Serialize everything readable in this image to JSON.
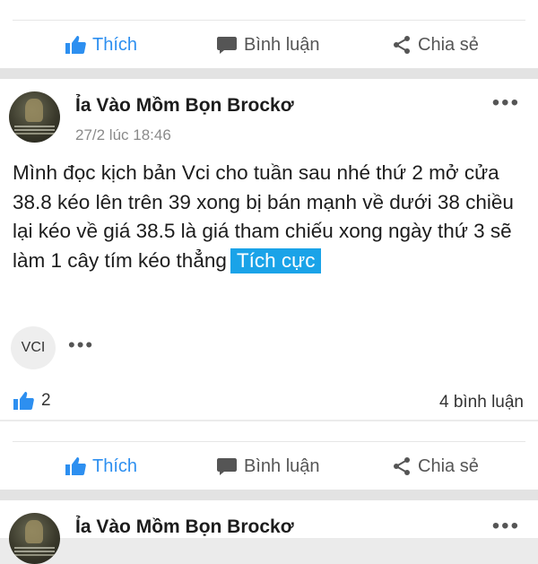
{
  "actions": {
    "like_label": "Thích",
    "comment_label": "Bình luận",
    "share_label": "Chia sẻ"
  },
  "post": {
    "author": "Ỉa Vào Mồm Bọn Brockơ",
    "time": "27/2 lúc 18:46",
    "content": "Mình đọc kịch bản Vci cho tuần sau nhé thứ 2 mở cửa 38.8 kéo lên trên 39 xong bị bán mạnh về dưới 38 chiều lại kéo về giá 38.5 là giá tham chiếu xong ngày thứ 3 sẽ làm 1 cây tím kéo thẳng",
    "sentiment_tag": "Tích cực",
    "stock_chip": "VCI",
    "likes": "2",
    "comments": "4 bình luận"
  },
  "next_post": {
    "author": "Ỉa Vào Mồm Bọn Brockơ"
  },
  "colors": {
    "accent": "#2d8ff0",
    "tag_bg": "#1aa3e8"
  }
}
